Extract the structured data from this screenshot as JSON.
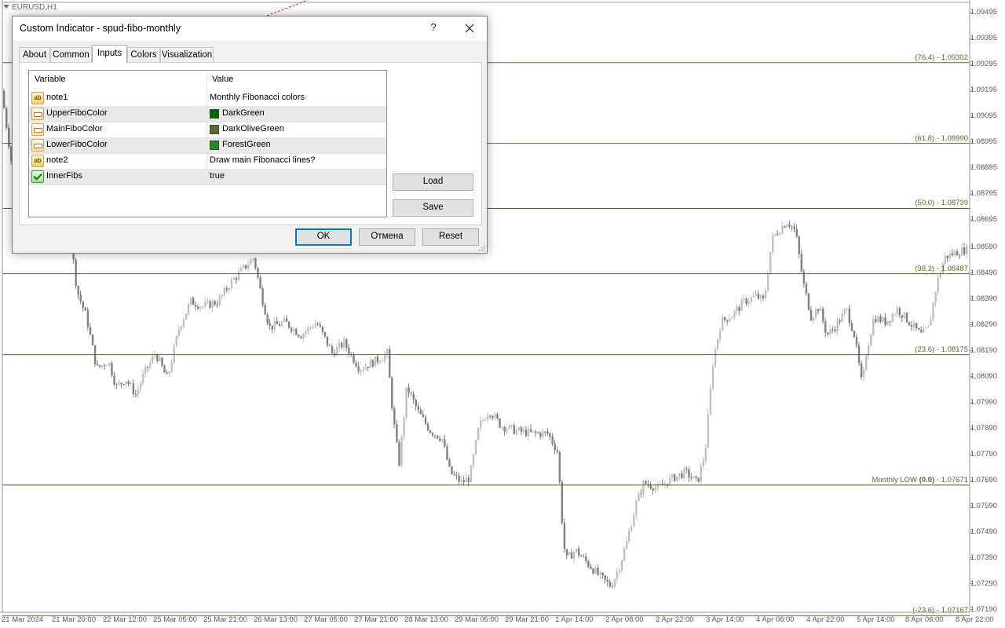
{
  "window": {
    "symbol_title": "EURUSD,H1"
  },
  "chart": {
    "price_axis": [
      "1.09495",
      "1.09395",
      "1.09295",
      "1.09195",
      "1.09095",
      "1.08995",
      "1.08895",
      "1.08795",
      "1.08695",
      "1.08590",
      "1.08490",
      "1.08390",
      "1.08290",
      "1.08190",
      "1.08090",
      "1.07990",
      "1.07890",
      "1.07790",
      "1.07690",
      "1.07590",
      "1.07490",
      "1.07390",
      "1.07290",
      "1.07190"
    ],
    "time_axis": [
      "21 Mar 2024",
      "21 Mar 20:00",
      "22 Mar 12:00",
      "25 Mar 05:00",
      "25 Mar 21:00",
      "26 Mar 13:00",
      "27 Mar 05:00",
      "27 Mar 21:00",
      "28 Mar 13:00",
      "29 Mar 05:00",
      "29 Mar 21:00",
      "1 Apr 14:00",
      "2 Apr 06:00",
      "2 Apr 22:00",
      "3 Apr 14:00",
      "4 Apr 06:00",
      "4 Apr 22:00",
      "5 Apr 14:00",
      "8 Apr 06:00",
      "8 Apr 22:00"
    ],
    "fib_levels": [
      {
        "prefix": "",
        "level": "(76.4)",
        "price": " - 1.09302"
      },
      {
        "prefix": "",
        "level": "(61.8)",
        "price": " - 1.08990"
      },
      {
        "prefix": "",
        "level": "(50.0)",
        "price": " - 1.08739"
      },
      {
        "prefix": "",
        "level": "(38.2)",
        "price": " - 1.08487"
      },
      {
        "prefix": "",
        "level": "(23.6)",
        "price": " - 1.08175"
      },
      {
        "prefix": "Monthly LOW ",
        "level": "(0.0)",
        "price": " - 1.07671"
      },
      {
        "prefix": "",
        "level": "(-23.6)",
        "price": " - 1.07167"
      }
    ],
    "colors": {
      "fib_line": "#556b2f",
      "bull_candle": "#c0c0c0",
      "bear_candle": "#808080",
      "trend_line": "#e02020"
    }
  },
  "dialog": {
    "title": "Custom Indicator - spud-fibo-monthly",
    "help": "?",
    "tabs": [
      {
        "label": "About"
      },
      {
        "label": "Common"
      },
      {
        "label": "Inputs"
      },
      {
        "label": "Colors"
      },
      {
        "label": "Visualization"
      }
    ],
    "active_tab": "Inputs",
    "columns": {
      "variable": "Variable",
      "value": "Value"
    },
    "rows": [
      {
        "icon": "ab",
        "variable": "note1",
        "value": "Monthly Fibonacci colors"
      },
      {
        "icon": "color",
        "variable": "UpperFiboColor",
        "value": "DarkGreen",
        "swatch": "#006400"
      },
      {
        "icon": "color",
        "variable": "MainFiboColor",
        "value": "DarkOliveGreen",
        "swatch": "#556B2F"
      },
      {
        "icon": "color",
        "variable": "LowerFiboColor",
        "value": "ForestGreen",
        "swatch": "#228B22"
      },
      {
        "icon": "ab",
        "variable": "note2",
        "value": "Draw main Fibonacci lines?"
      },
      {
        "icon": "bool",
        "variable": "InnerFibs",
        "value": "true"
      }
    ],
    "buttons": {
      "load": "Load",
      "save": "Save",
      "ok": "OK",
      "cancel": "Отмена",
      "reset": "Reset"
    }
  }
}
